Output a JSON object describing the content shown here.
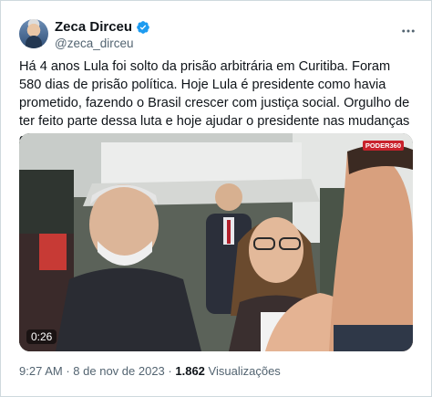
{
  "author": {
    "display_name": "Zeca Dirceu",
    "handle": "@zeca_dirceu",
    "verified_badge_color": "#1d9bf0"
  },
  "more_icon": "more-horizontal-icon",
  "tweet": {
    "text": "Há 4 anos Lula foi solto da prisão arbitrária em Curitiba. Foram 580 dias de prisão política. Hoje Lula é presidente como havia prometido, fazendo o Brasil crescer com justiça social. Orgulho de ter feito parte dessa luta e hoje ajudar o presidente nas mudanças que o país precisa"
  },
  "media": {
    "channel_logo": "PODER360",
    "duration": "0:26"
  },
  "meta": {
    "time": "9:27 AM",
    "separator": "·",
    "date": "8 de nov de 2023",
    "views_count": "1.862",
    "views_label": "Visualizações"
  },
  "colors": {
    "text_primary": "#0f1419",
    "text_secondary": "#536471",
    "border": "#cfd9de"
  }
}
